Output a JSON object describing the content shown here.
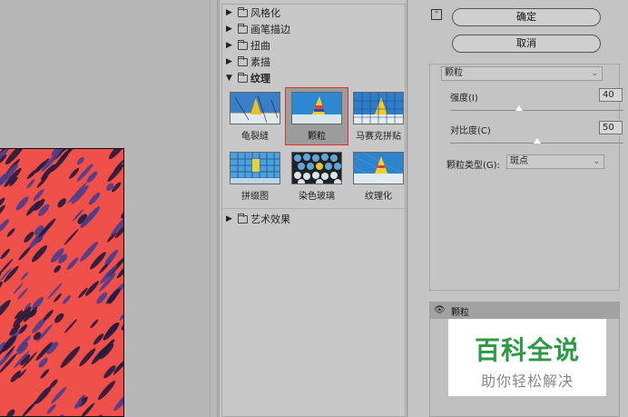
{
  "gallery": {
    "categories_top": [
      {
        "label": "风格化",
        "open": false
      },
      {
        "label": "画笔描边",
        "open": false
      },
      {
        "label": "扭曲",
        "open": false
      },
      {
        "label": "素描",
        "open": false
      }
    ],
    "open_category": {
      "label": "纹理",
      "open": true
    },
    "thumbs": [
      {
        "label": "龟裂缝",
        "selected": false
      },
      {
        "label": "颗粒",
        "selected": true
      },
      {
        "label": "马赛克拼贴",
        "selected": false
      },
      {
        "label": "拼缀图",
        "selected": false
      },
      {
        "label": "染色玻璃",
        "selected": false
      },
      {
        "label": "纹理化",
        "selected": false
      }
    ],
    "categories_bottom": [
      {
        "label": "艺术效果",
        "open": false
      }
    ]
  },
  "panel": {
    "ok_label": "确定",
    "cancel_label": "取消",
    "filter_select": "颗粒",
    "intensity_label": "强度(I)",
    "intensity_value": "40",
    "intensity_level": 40,
    "contrast_label": "对比度(C)",
    "contrast_value": "50",
    "contrast_level": 50,
    "grain_type_label": "颗粒类型(G):",
    "grain_type_value": "斑点"
  },
  "layers": {
    "layer_name": "颗粒"
  },
  "watermark": {
    "title": "百科全说",
    "subtitle": "助你轻松解决"
  },
  "colors": {
    "accent_selection": "#e0302a",
    "watermark_green": "#2e9a46",
    "preview_red": "#f0504a"
  }
}
